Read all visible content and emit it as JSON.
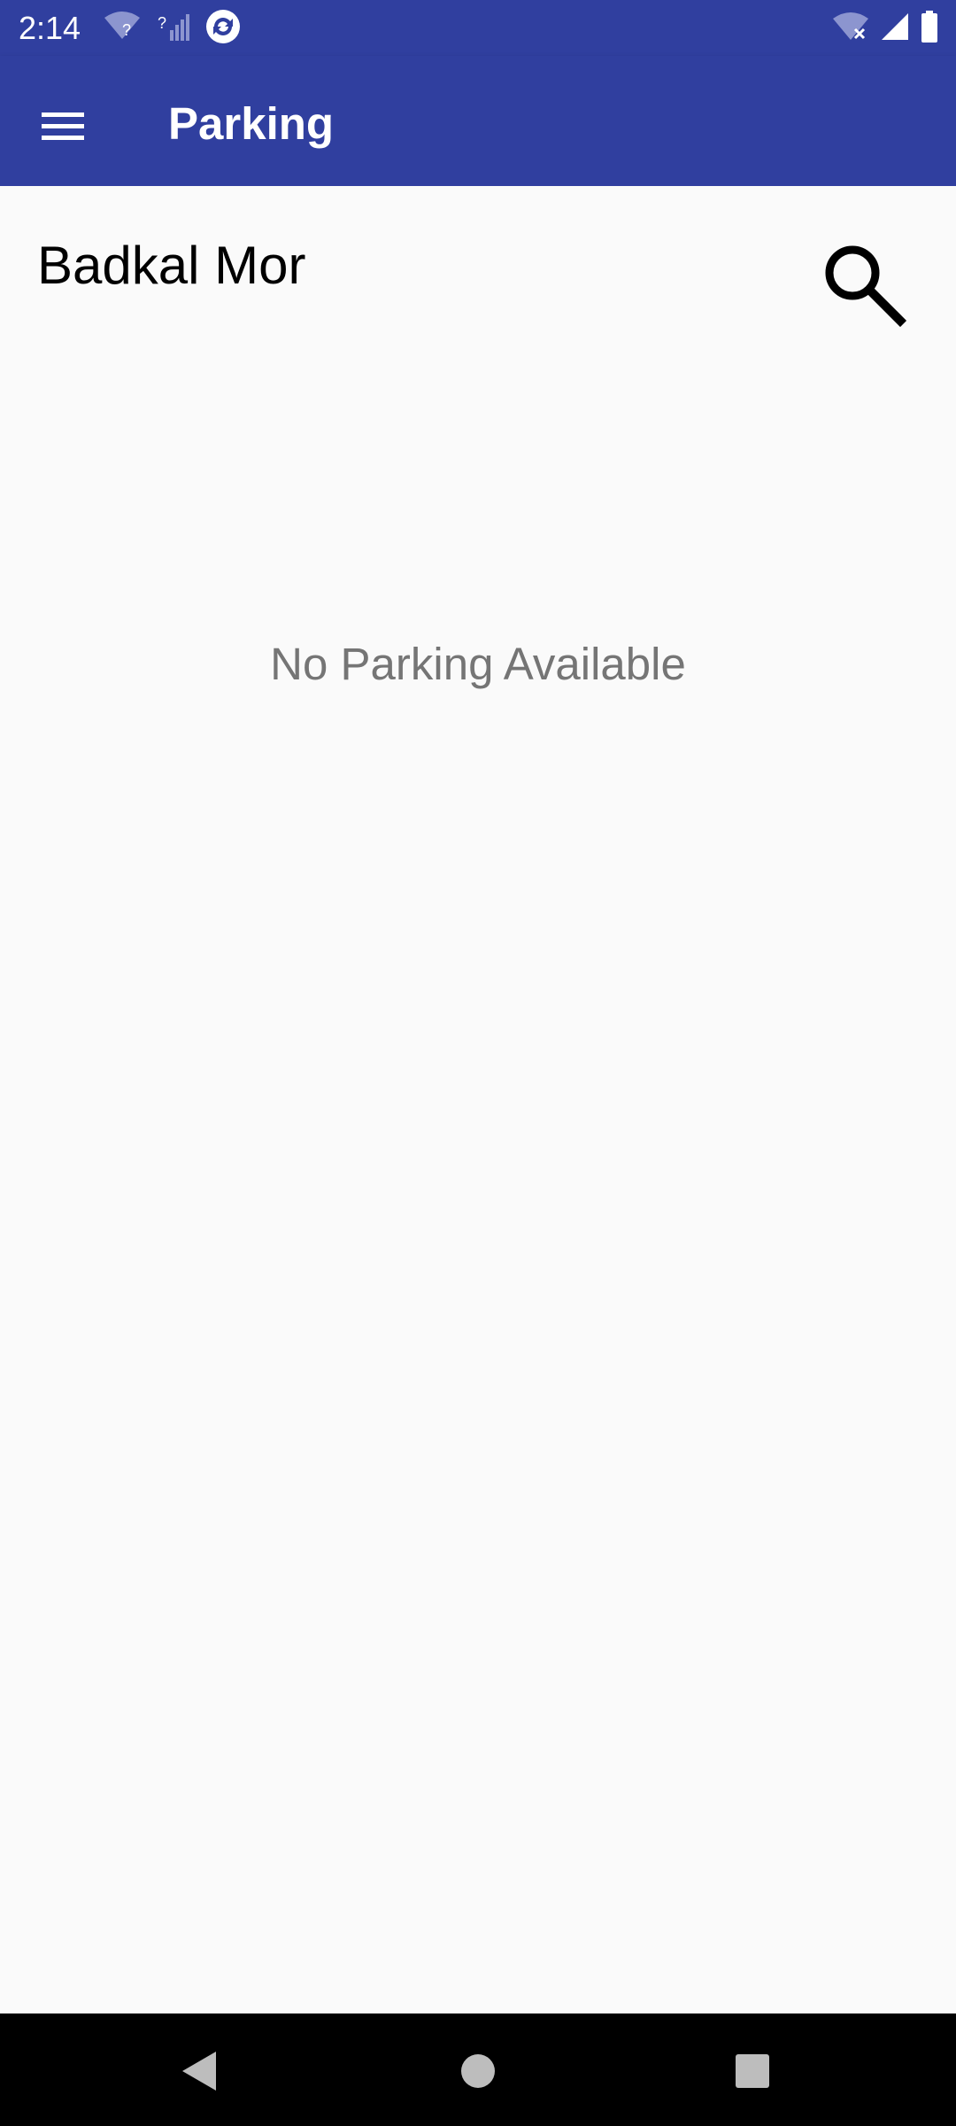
{
  "status_bar": {
    "time": "2:14",
    "color": "#303f9f"
  },
  "app_bar": {
    "title": "Parking",
    "menu_icon": "hamburger-menu-icon",
    "color": "#303f9f"
  },
  "location": {
    "name": "Badkal Mor",
    "search_icon": "search-icon"
  },
  "empty_state": {
    "message": "No Parking Available"
  },
  "nav_bar": {
    "back_icon": "back-icon",
    "home_icon": "home-icon",
    "recents_icon": "recents-icon"
  }
}
